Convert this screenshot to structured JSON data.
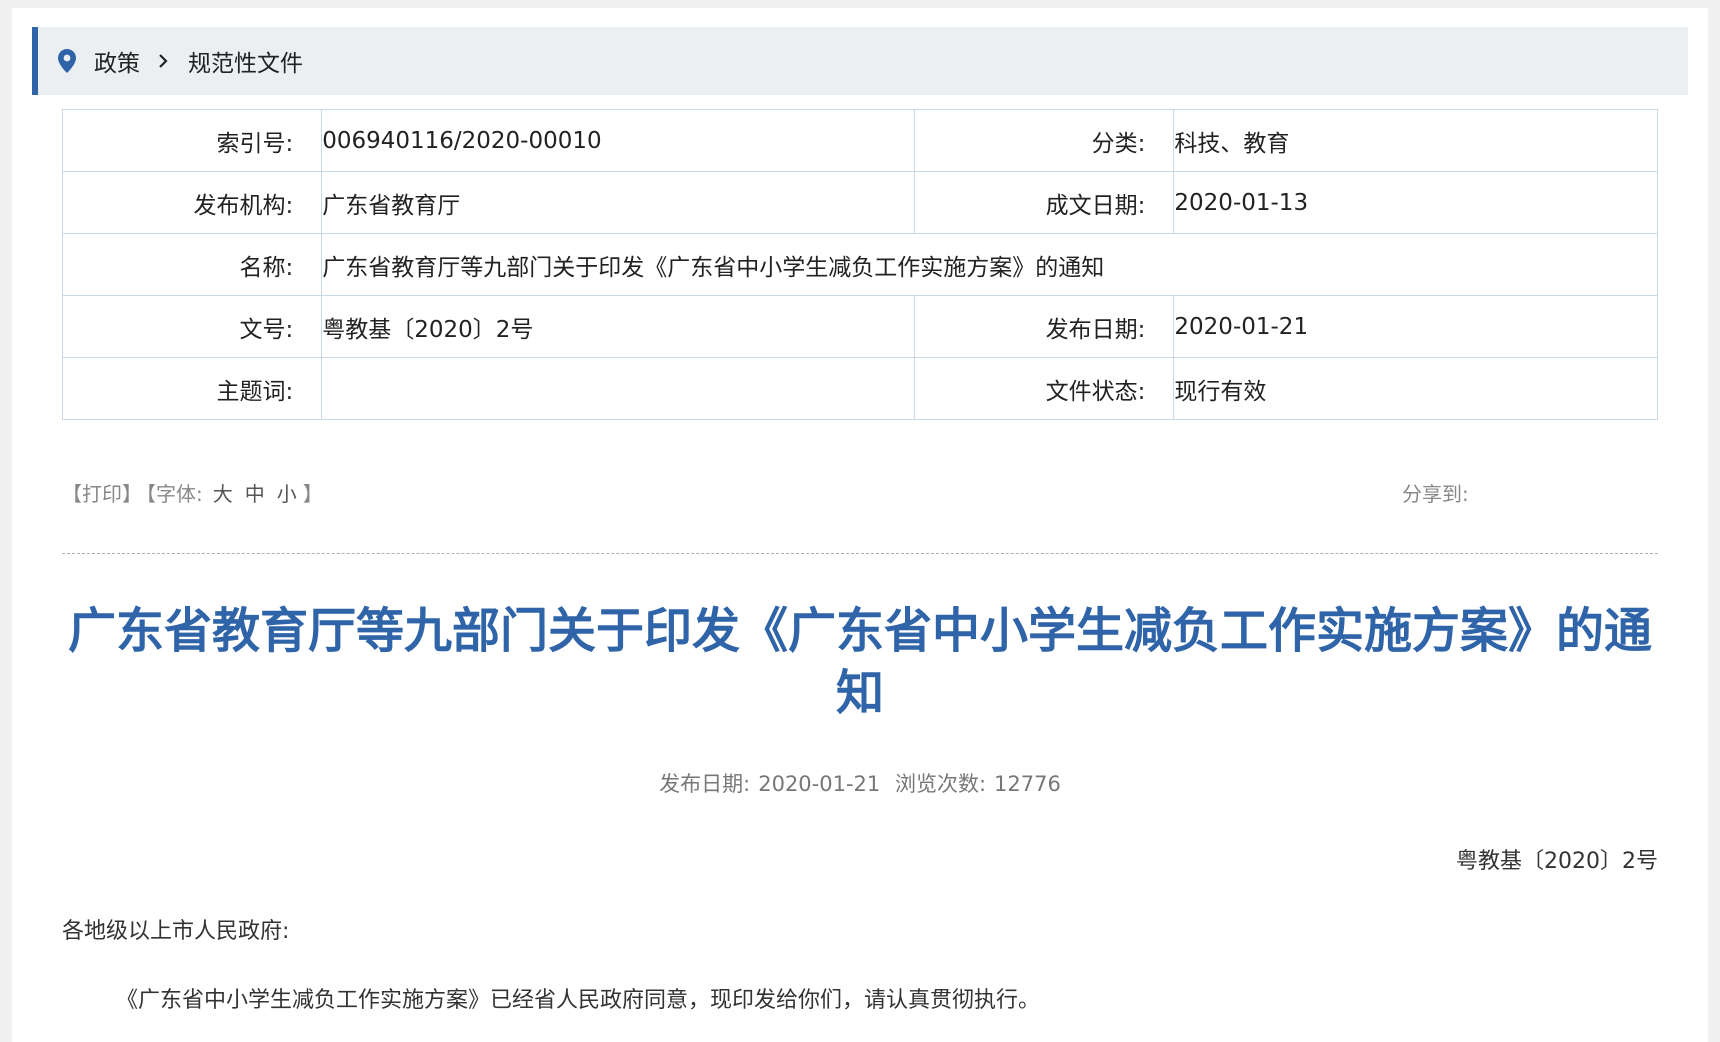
{
  "breadcrumb": {
    "items": [
      "政策",
      "规范性文件"
    ]
  },
  "meta": {
    "index_label": "索引号:",
    "index_value": "006940116/2020-00010",
    "category_label": "分类:",
    "category_value": "科技、教育",
    "issuer_label": "发布机构:",
    "issuer_value": "广东省教育厅",
    "written_label": "成文日期:",
    "written_value": "2020-01-13",
    "name_label": "名称:",
    "name_value": "广东省教育厅等九部门关于印发《广东省中小学生减负工作实施方案》的通知",
    "docno_label": "文号:",
    "docno_value": "粤教基〔2020〕2号",
    "pubdate_label": "发布日期:",
    "pubdate_value": "2020-01-21",
    "keywords_label": "主题词:",
    "keywords_value": "",
    "status_label": "文件状态:",
    "status_value": "现行有效"
  },
  "tools": {
    "print": "【打印】",
    "font_prefix": "【字体:",
    "font_large": "大",
    "font_medium": "中",
    "font_small": "小",
    "font_suffix": "】",
    "share": "分享到:"
  },
  "article": {
    "title": "广东省教育厅等九部门关于印发《广东省中小学生减负工作实施方案》的通知",
    "pub_label": "发布日期:",
    "pub_date": "2020-01-21",
    "views_label": "浏览次数:",
    "views": "12776",
    "doc_number": "粤教基〔2020〕2号",
    "salutation": "各地级以上市人民政府:",
    "paragraph1": "《广东省中小学生减负工作实施方案》已经省人民政府同意，现印发给你们，请认真贯彻执行。"
  },
  "colors": {
    "accent": "#2f64a8",
    "breadcrumb_bg": "#eceff2",
    "table_border": "#c9d9ea"
  }
}
